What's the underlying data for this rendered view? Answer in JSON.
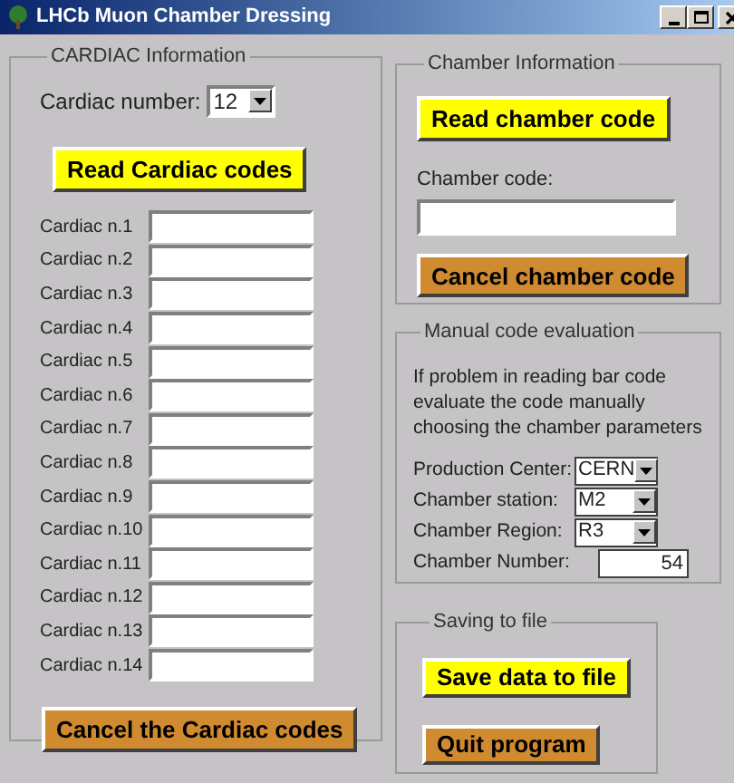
{
  "window": {
    "title": "LHCb Muon Chamber Dressing"
  },
  "cardiac": {
    "legend": "CARDIAC Information",
    "number_label": "Cardiac number:",
    "number_value": "12",
    "read_button": "Read Cardiac codes",
    "fields": [
      {
        "label": "Cardiac n.1"
      },
      {
        "label": "Cardiac n.2"
      },
      {
        "label": "Cardiac n.3"
      },
      {
        "label": "Cardiac n.4"
      },
      {
        "label": "Cardiac n.5"
      },
      {
        "label": "Cardiac n.6"
      },
      {
        "label": "Cardiac n.7"
      },
      {
        "label": "Cardiac n.8"
      },
      {
        "label": "Cardiac n.9"
      },
      {
        "label": "Cardiac n.10"
      },
      {
        "label": "Cardiac n.11"
      },
      {
        "label": "Cardiac n.12"
      },
      {
        "label": "Cardiac n.13"
      },
      {
        "label": "Cardiac n.14"
      }
    ],
    "cancel_button": "Cancel the Cardiac codes"
  },
  "chamber": {
    "legend": "Chamber Information",
    "read_button": "Read chamber code",
    "code_label": "Chamber code:",
    "cancel_button": "Cancel chamber code"
  },
  "manual": {
    "legend": "Manual code evaluation",
    "description": "If problem in reading bar code evaluate the code manually choosing the chamber parameters",
    "params": [
      {
        "kind": "select",
        "label": "Production Center:",
        "value": "CERN"
      },
      {
        "kind": "select",
        "label": "Chamber station:",
        "value": "M2"
      },
      {
        "kind": "select",
        "label": "Chamber Region:",
        "value": "R3"
      },
      {
        "kind": "number",
        "label": "Chamber Number:",
        "value": "54"
      }
    ]
  },
  "saving": {
    "legend": "Saving to file",
    "save_button": "Save data to file",
    "quit_button": "Quit program"
  }
}
